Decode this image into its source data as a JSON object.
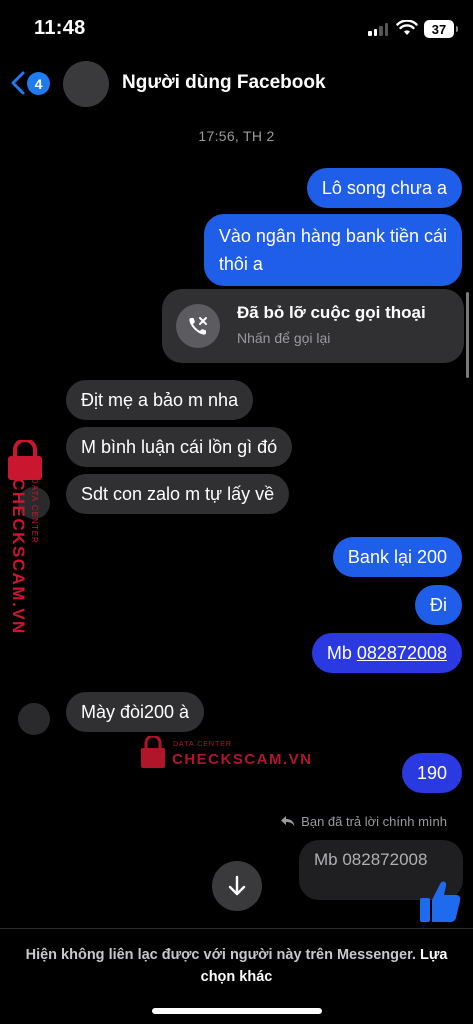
{
  "status_bar": {
    "time": "11:48",
    "battery": "37",
    "icons": [
      "signal-icon",
      "wifi-icon",
      "battery-icon"
    ]
  },
  "header": {
    "back_badge": "4",
    "title": "Người dùng Facebook",
    "icons": [
      "back-chevron-icon",
      "avatar"
    ]
  },
  "timestamp": "17:56, TH 2",
  "messages": {
    "m1": "Lô song chưa a",
    "m2_line1": "Vào ngân hàng bank tiền cái",
    "m2_line2": "thôi a",
    "missed_call": {
      "title": "Đã bỏ lỡ cuộc gọi thoại",
      "subtitle": "Nhấn để gọi lại",
      "icon": "missed-call-icon"
    },
    "m3": "Địt mẹ a bảo m nha",
    "m4": "M bình luận cái lồn gì đó",
    "m5": "Sdt con zalo m tự lấy về",
    "m6": "Bank lại 200",
    "m7": "Đi",
    "m8_prefix": "Mb ",
    "m8_number": "082872008",
    "m9": "Mày đòi200 à",
    "m10": "190",
    "reply_note": "Bạn đã trả lời chính mình",
    "reply_quote": "Mb 082872008"
  },
  "watermark": {
    "label_small": "DATA CENTER",
    "label_big": "CHECKSCAM.VN"
  },
  "footer": {
    "notice": "Hiện không liên lạc được với người này trên Messenger.",
    "link": "Lựa chọn khác"
  },
  "colors": {
    "outgoing": "#1f5ee8",
    "outgoing_violet": "#2a3ae0",
    "incoming": "#303033",
    "accent": "#1e7bf2",
    "watermark": "#c8172e"
  }
}
